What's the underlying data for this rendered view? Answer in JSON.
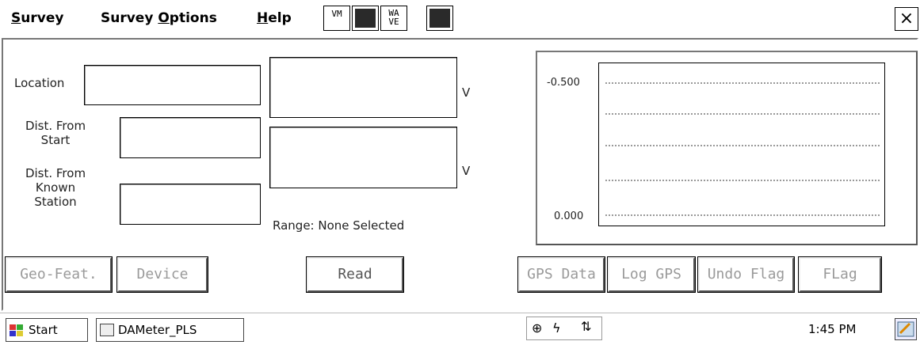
{
  "menu": {
    "survey": "urvey",
    "survey_underline": "S",
    "survey_options_prefix": "Survey ",
    "survey_options_underline": "O",
    "survey_options_rest": "ptions",
    "help_underline": "H",
    "help_rest": "elp"
  },
  "toolbar": {
    "vm_label": "VM",
    "wave_label_1": "WA",
    "wave_label_2": "VE"
  },
  "window": {
    "close_label": "×"
  },
  "form": {
    "location_label": "Location",
    "location_value": "",
    "dist_start_label_1": "Dist. From",
    "dist_start_label_2": "Start",
    "dist_start_value": "",
    "dist_known_label_1": "Dist. From",
    "dist_known_label_2": "Known",
    "dist_known_label_3": "Station",
    "dist_known_value": "",
    "reading1_value": "",
    "reading1_unit": "V",
    "reading2_value": "",
    "reading2_unit": "V",
    "range_text": "Range: None Selected"
  },
  "buttons": {
    "geo_feat": "Geo-Feat.",
    "device": "Device",
    "read": "Read",
    "gps_data": "GPS Data",
    "log_gps": "Log GPS",
    "undo_flag": "Undo Flag",
    "flag": "FLag"
  },
  "chart_data": {
    "type": "line",
    "title": "",
    "xlabel": "",
    "ylabel": "",
    "yticks": [
      "-0.500",
      "0.000"
    ],
    "ylim": [
      0.0,
      -0.5
    ],
    "grid": true,
    "series": []
  },
  "taskbar": {
    "start_label": "Start",
    "task_label": "DAMeter_PLS",
    "clock": "1:45 PM"
  },
  "icons": {
    "start": "windows-flag-icon",
    "task": "app-icon",
    "network": "network-icon",
    "battery": "power-icon",
    "sync": "sync-icon",
    "tray": "desktop-icon"
  }
}
